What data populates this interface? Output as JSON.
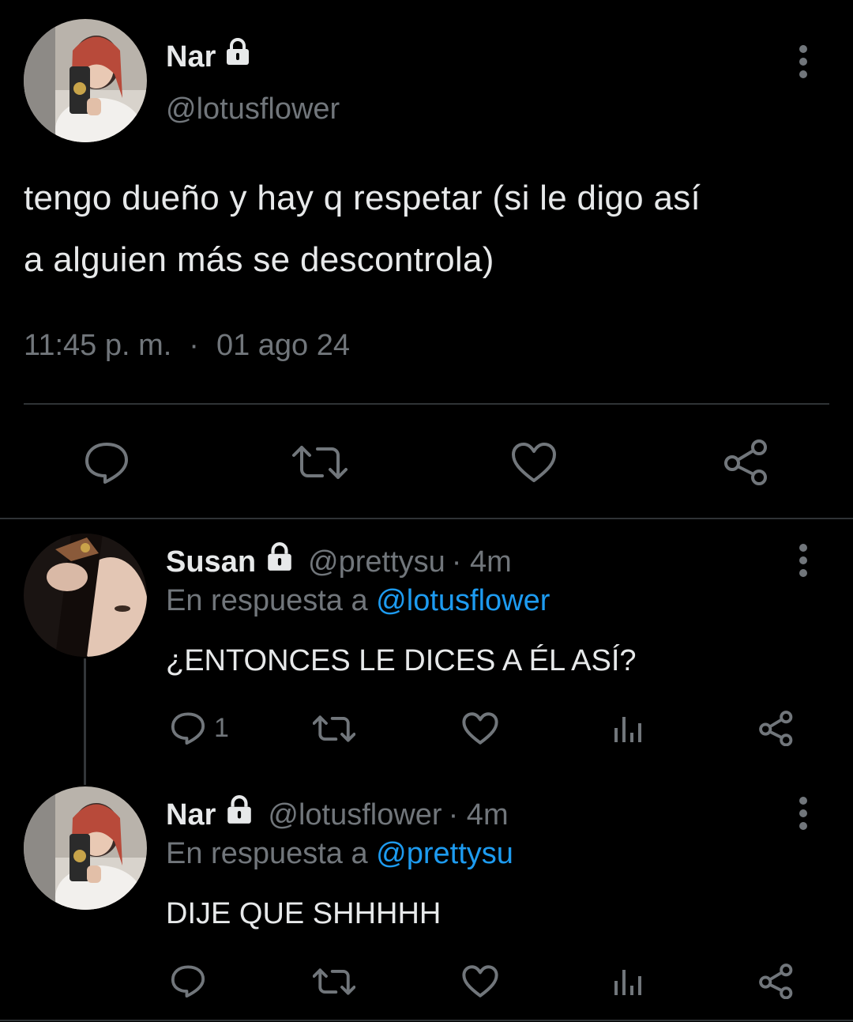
{
  "main_tweet": {
    "author_name": "Nar",
    "handle": "@lotusflower",
    "text_line1": "tengo dueño y hay q respetar (si le digo así",
    "text_line2": "a alguien más se descontrola)",
    "time": "11:45 p. m.",
    "separator": "·",
    "date": "01 ago 24"
  },
  "reply1": {
    "author_name": "Susan",
    "handle": "@prettysu",
    "age": "· 4m",
    "reply_prefix": "En respuesta a",
    "reply_to": "@lotusflower",
    "text": "¿ENTONCES LE DICES A ÉL ASÍ?",
    "reply_count": "1"
  },
  "reply2": {
    "author_name": "Nar",
    "handle": "@lotusflower",
    "age": "· 4m",
    "reply_prefix": "En respuesta a",
    "reply_to": "@prettysu",
    "text": "DIJE QUE SHHHHH"
  },
  "colors": {
    "background": "#000000",
    "text": "#e7e9ea",
    "muted": "#71767b",
    "link": "#1d9bf0",
    "divider": "#2f3336"
  },
  "icons": [
    "lock-icon",
    "more-icon",
    "reply-icon",
    "retweet-icon",
    "like-icon",
    "share-icon",
    "views-icon"
  ]
}
